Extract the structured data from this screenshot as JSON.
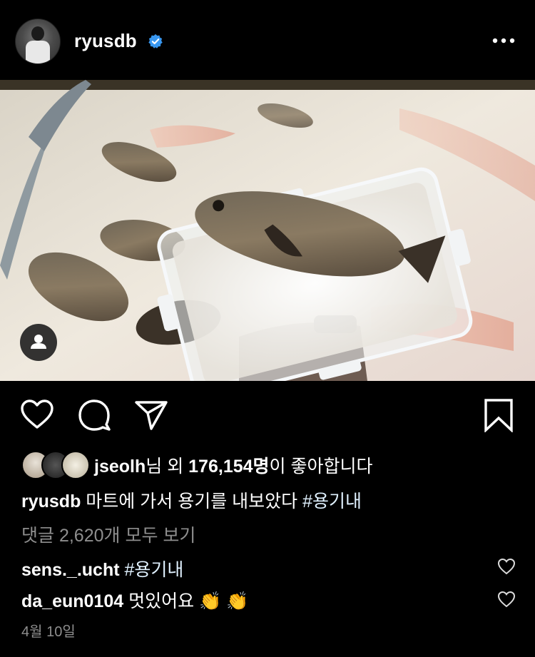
{
  "post": {
    "username": "ryusdb",
    "verified": true,
    "likes_user": "jseolh",
    "likes_mid": "님 외 ",
    "likes_count": "176,154명",
    "likes_suffix": "이 좋아합니다",
    "caption_user": "ryusdb",
    "caption_text": " 마트에 가서 용기를 내보았다 ",
    "caption_hashtag": "#용기내",
    "view_all_comments": "댓글 2,620개 모두 보기",
    "date": "4월 10일"
  },
  "comments": [
    {
      "user": "sens._.ucht",
      "text": " #용기내",
      "emoji": ""
    },
    {
      "user": "da_eun0104",
      "text": " 멋있어요",
      "emoji": "👏 👏"
    }
  ],
  "icons": {
    "more": "more-icon",
    "verified": "verified-badge-icon",
    "tag": "user-tag-icon",
    "like": "heart-icon",
    "comment": "comment-icon",
    "share": "send-icon",
    "save": "bookmark-icon"
  },
  "colors": {
    "background": "#000000",
    "text": "#ffffff",
    "muted": "#8e8e8e",
    "verified_blue": "#3897f0",
    "hashtag": "#e0f1ff"
  }
}
